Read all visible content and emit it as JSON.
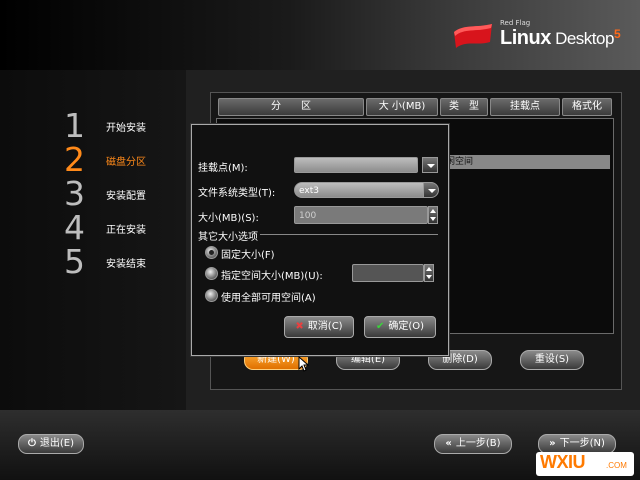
{
  "brand": {
    "small": "Red Flag",
    "name_bold": "Linux",
    "name_light": " Desktop",
    "version": "5"
  },
  "steps": [
    {
      "num": "1",
      "label": "开始安装"
    },
    {
      "num": "2",
      "label": "磁盘分区"
    },
    {
      "num": "3",
      "label": "安装配置"
    },
    {
      "num": "4",
      "label": "正在安装"
    },
    {
      "num": "5",
      "label": "安装结束"
    }
  ],
  "table": {
    "columns": [
      "分　　区",
      "大 小(MB)",
      "类　型",
      "挂载点",
      "格式化"
    ],
    "selected_row_text": "闲空间"
  },
  "actions": {
    "new": "新建(W)",
    "edit": "编辑(E)",
    "delete": "删除(D)",
    "reset": "重设(S)"
  },
  "dialog": {
    "mount_label": "挂载点(M):",
    "mount_value": "",
    "fs_label": "文件系统类型(T):",
    "fs_value": "ext3",
    "size_label": "大小(MB)(S):",
    "size_value": "100",
    "group_title": "其它大小选项",
    "opt_fixed": "固定大小(F)",
    "opt_max": "指定空间大小(MB)(U):",
    "opt_max_value": "",
    "opt_all": "使用全部可用空间(A)",
    "cancel": "取消(C)",
    "ok": "确定(O)"
  },
  "nav": {
    "exit": "退出(E)",
    "back": "上一步(B)",
    "next": "下一步(N)"
  },
  "watermark": {
    "text": "WXIU",
    "domain": ".COM"
  },
  "colors": {
    "accent": "#ff8a1a",
    "background": "#000000"
  }
}
